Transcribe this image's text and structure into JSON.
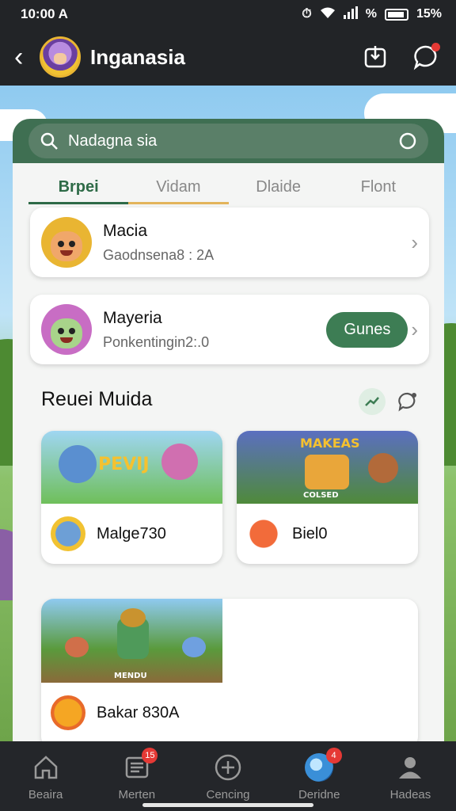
{
  "status_bar": {
    "time": "10:00 A",
    "battery_text": "15%",
    "percent_symbol": "%"
  },
  "header": {
    "title": "Inganasia"
  },
  "search": {
    "value": "Nadagna sia"
  },
  "tabs": [
    {
      "label": "Brpei"
    },
    {
      "label": "Vidam"
    },
    {
      "label": "Dlaide"
    },
    {
      "label": "Flont"
    }
  ],
  "friends": [
    {
      "name": "Macia",
      "subtitle": "Gaodnsena8 : 2A"
    },
    {
      "name": "Mayeria",
      "subtitle": "Ponkentingin2:.0",
      "action_label": "Gunes"
    }
  ],
  "section": {
    "title": "Reuei Muida"
  },
  "games": [
    {
      "label": "Malge730",
      "banner": "PEVIJ"
    },
    {
      "label": "Biel0",
      "banner": "MAKEAS",
      "banner_caption": "COLSED"
    },
    {
      "label": "Bakar 830A",
      "banner_caption": "MENDU"
    }
  ],
  "bottom_nav": [
    {
      "label": "Beaira",
      "icon": "home-icon"
    },
    {
      "label": "Merten",
      "icon": "news-icon",
      "badge": "15"
    },
    {
      "label": "Cencing",
      "icon": "add-circle-icon"
    },
    {
      "label": "Deridne",
      "icon": "game-orb-icon",
      "badge": "4"
    },
    {
      "label": "Hadeas",
      "icon": "profile-icon"
    }
  ],
  "colors": {
    "accent": "#3d7d54",
    "header_bg": "#222427",
    "badge": "#e53935"
  }
}
